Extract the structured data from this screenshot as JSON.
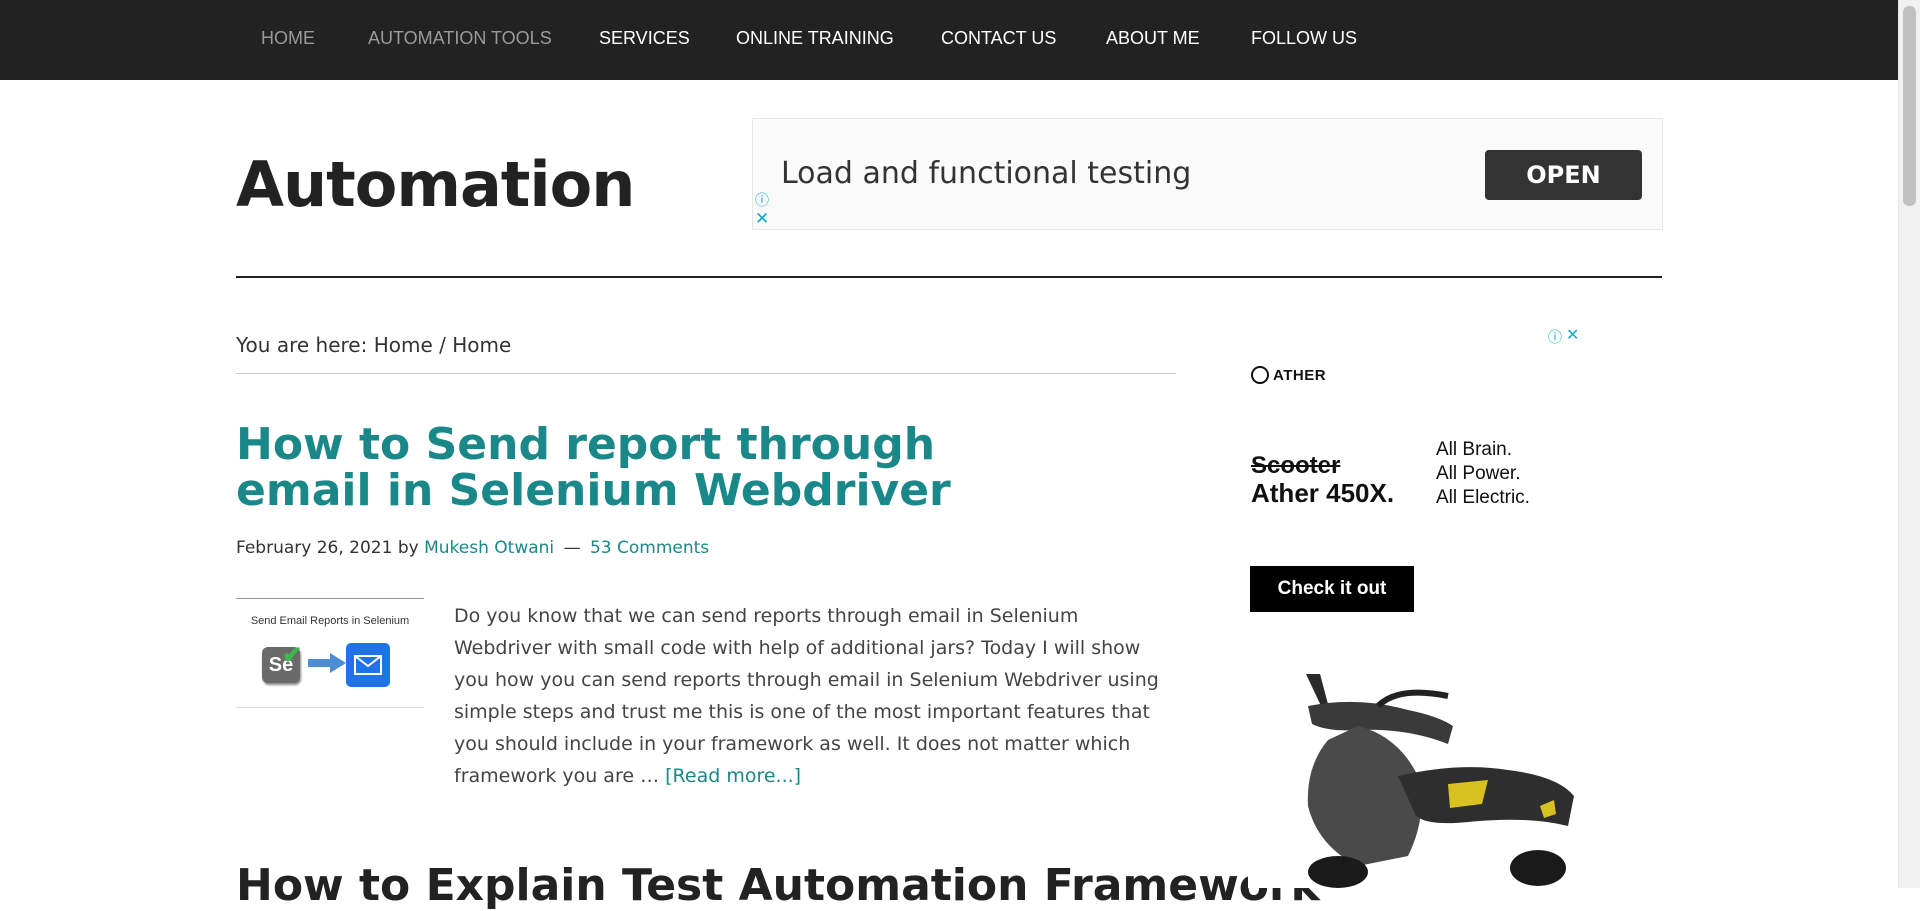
{
  "nav": {
    "items": [
      {
        "label": "HOME"
      },
      {
        "label": "AUTOMATION TOOLS"
      },
      {
        "label": "SERVICES"
      },
      {
        "label": "ONLINE TRAINING"
      },
      {
        "label": "CONTACT US"
      },
      {
        "label": "ABOUT ME"
      },
      {
        "label": "FOLLOW US"
      }
    ]
  },
  "site": {
    "title": "Automation"
  },
  "ad_top": {
    "text": "Load and functional testing",
    "button": "OPEN",
    "info_icon": "info-circle-icon",
    "close_icon": "close-x-icon",
    "accent_color": "#00aecd"
  },
  "breadcrumb": {
    "prefix": "You are here:",
    "items": [
      "Home",
      "Home"
    ],
    "separator": "/"
  },
  "post": {
    "title": "How to Send report through email in Selenium Webdriver",
    "date": "February 26, 2021",
    "by": "by",
    "author": "Mukesh Otwani",
    "dash": "—",
    "comments": "53 Comments",
    "thumbnail_caption": "Send Email Reports in Selenium",
    "thumbnail_logo": "Se",
    "excerpt": "Do you know that we can send reports through email in Selenium Webdriver with small code with help of additional jars? Today I will show you how you can send reports through email in Selenium Webdriver using simple steps and trust me this is one of the most important features that you should include in your framework as well. It does not matter which framework you are …",
    "read_more": "[Read more...]",
    "link_color": "#1a8888"
  },
  "next_post": {
    "title": "How to Explain Test Automation Framework"
  },
  "ad_side": {
    "brand": "ATHER",
    "strike_word": "Scooter",
    "model": "Ather 450X.",
    "tagline": [
      "All Brain.",
      "All Power.",
      "All Electric."
    ],
    "button": "Check it out"
  }
}
